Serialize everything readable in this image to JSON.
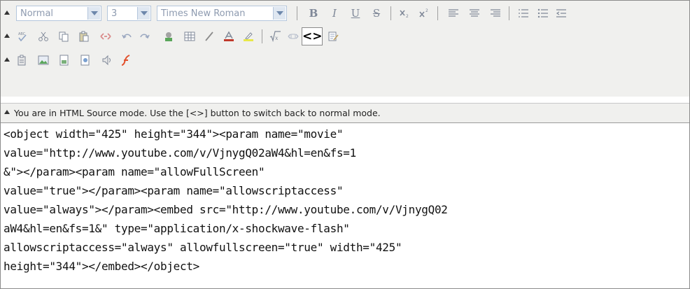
{
  "toolbar": {
    "format_select": {
      "value": "Normal"
    },
    "size_select": {
      "value": "3"
    },
    "font_select": {
      "value": "Times New Roman"
    },
    "row1_icons": [
      "bold-icon",
      "italic-icon",
      "underline-icon",
      "strikethrough-icon",
      "subscript-icon",
      "superscript-icon",
      "align-left-icon",
      "align-center-icon",
      "align-right-icon",
      "numbered-list-icon",
      "bullet-list-icon",
      "outdent-icon"
    ],
    "row2_icons": [
      "spellcheck-icon",
      "cut-icon",
      "copy-icon",
      "paste-icon",
      "link-icon",
      "undo-icon",
      "redo-icon",
      "image-icon",
      "table-icon",
      "draw-icon",
      "font-color-icon",
      "highlight-icon",
      "math-formula-icon",
      "anchor-icon",
      "html-source-icon",
      "edit-form-icon"
    ],
    "row3_icons": [
      "paste-text-icon",
      "insert-image-icon",
      "save-doc-icon",
      "new-doc-icon",
      "media-icon",
      "flash-icon"
    ],
    "bold_glyph": "B",
    "italic_glyph": "I",
    "underline_glyph": "U",
    "strike_glyph": "S",
    "source_glyph": "<>",
    "accent_color": "#c0392b",
    "highlight_color": "#e8e84a"
  },
  "status": {
    "message": "You are in HTML Source mode. Use the [<>] button to switch back to normal mode."
  },
  "source": {
    "lines": [
      "<object width=\"425\" height=\"344\"><param name=\"movie\"",
      "value=\"http://www.youtube.com/v/VjnygQ02aW4&hl=en&fs=1",
      "&\"></param><param name=\"allowFullScreen\"",
      "value=\"true\"></param><param name=\"allowscriptaccess\"",
      "value=\"always\"></param><embed src=\"http://www.youtube.com/v/VjnygQ02",
      "aW4&hl=en&fs=1&\" type=\"application/x-shockwave-flash\"",
      "allowscriptaccess=\"always\" allowfullscreen=\"true\" width=\"425\"",
      "height=\"344\"></embed></object>"
    ]
  }
}
